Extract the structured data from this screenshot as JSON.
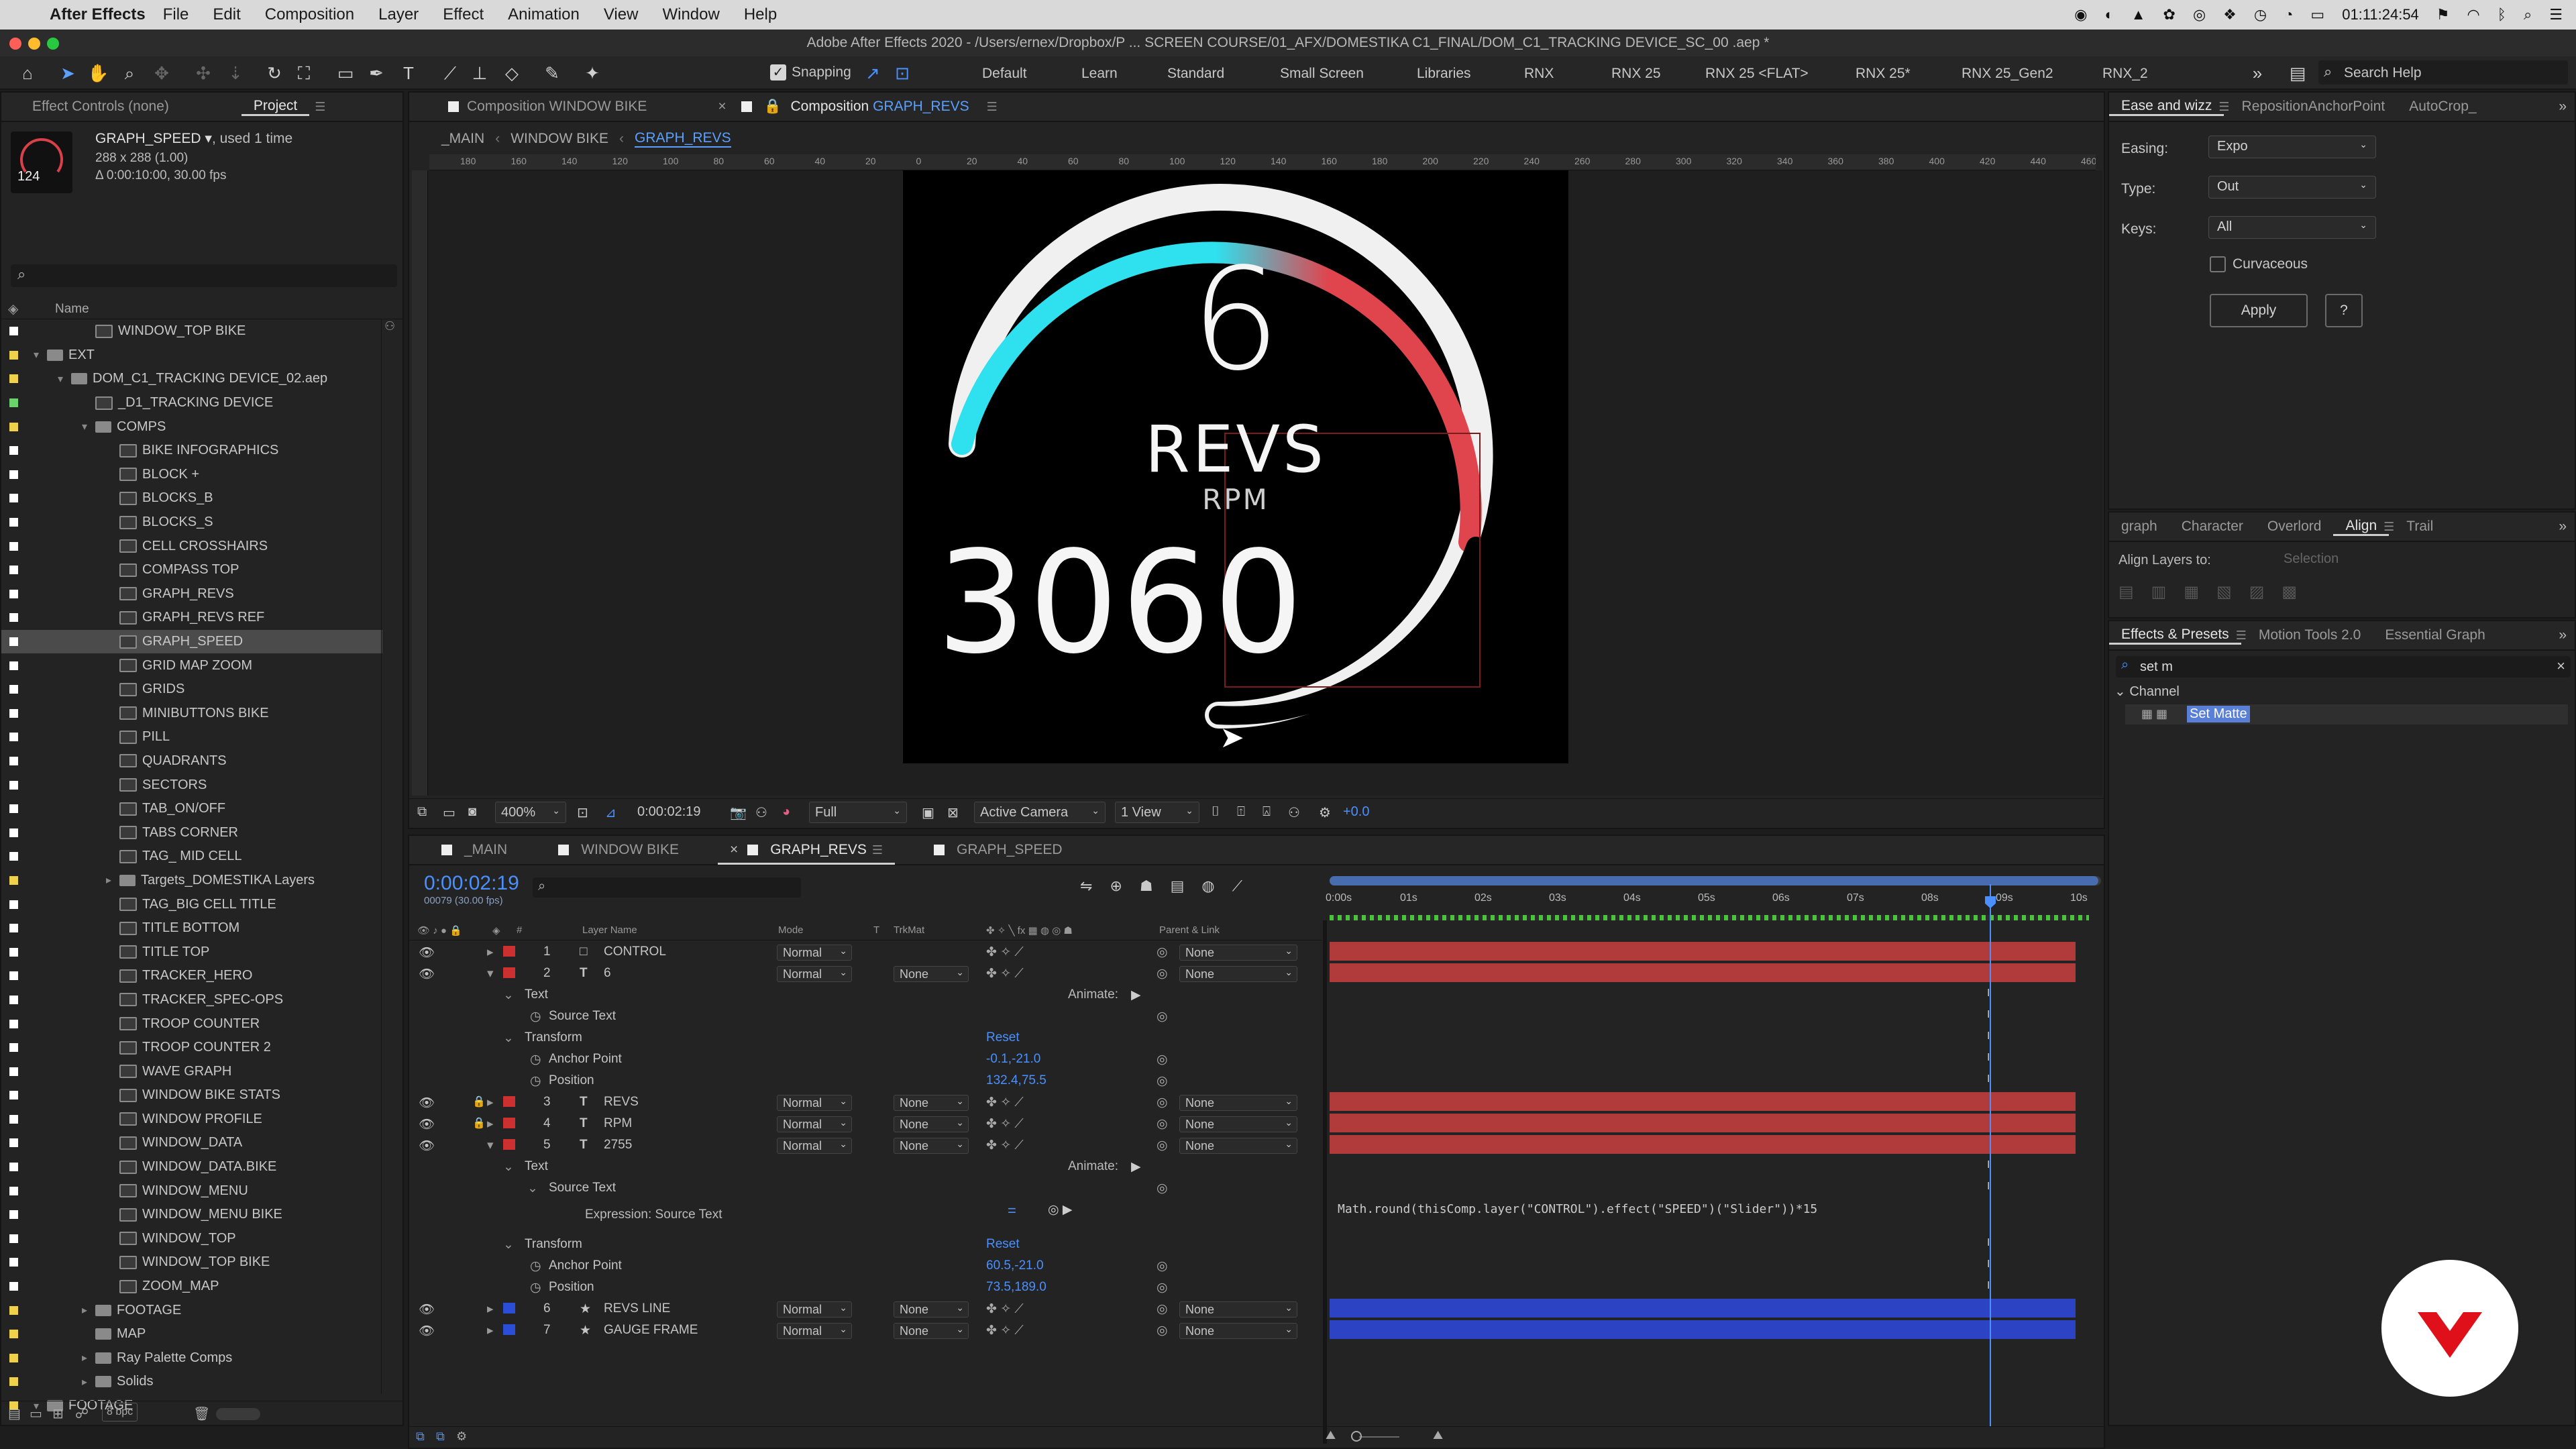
{
  "menubar": {
    "app": "After Effects",
    "items": [
      "File",
      "Edit",
      "Composition",
      "Layer",
      "Effect",
      "Animation",
      "View",
      "Window",
      "Help"
    ],
    "clock": "01:11:24:54"
  },
  "window_title": "Adobe After Effects 2020 - /Users/ernex/Dropbox/P ... SCREEN COURSE/01_AFX/DOMESTIKA C1_FINAL/DOM_C1_TRACKING DEVICE_SC_00 .aep *",
  "toolbar": {
    "snapping": "Snapping",
    "workspaces": [
      "Default",
      "Learn",
      "Standard",
      "Small Screen",
      "Libraries",
      "RNX",
      "RNX 25",
      "RNX 25 <FLAT>",
      "RNX 25*",
      "RNX 25_Gen2",
      "RNX_2"
    ],
    "search_help": "Search Help"
  },
  "left_panel": {
    "tabs": [
      "Effect Controls (none)",
      "Project"
    ],
    "selected_item": {
      "name": "GRAPH_SPEED ▾",
      "used": ", used 1 time",
      "size": "288 x 288 (1.00)",
      "duration": "Δ 0:00:10:00, 30.00 fps",
      "thumb_value": "124"
    },
    "search_placeholder": "",
    "column_name": "Name",
    "items": [
      {
        "name": "WINDOW_TOP BIKE",
        "kind": "comp",
        "indent": 2,
        "label": "#ffffff"
      },
      {
        "name": "EXT",
        "kind": "folder",
        "indent": 0,
        "twist": "▾",
        "label": "#f0d24a"
      },
      {
        "name": "DOM_C1_TRACKING DEVICE_02.aep",
        "kind": "folder",
        "indent": 1,
        "twist": "▾",
        "label": "#f0d24a"
      },
      {
        "name": "_D1_TRACKING DEVICE",
        "kind": "comp",
        "indent": 2,
        "label": "#6bd36b"
      },
      {
        "name": "COMPS",
        "kind": "folder",
        "indent": 2,
        "twist": "▾",
        "label": "#f0d24a"
      },
      {
        "name": "BIKE INFOGRAPHICS",
        "kind": "comp",
        "indent": 3,
        "label": "#ffffff"
      },
      {
        "name": "BLOCK +",
        "kind": "comp",
        "indent": 3,
        "label": "#ffffff"
      },
      {
        "name": "BLOCKS_B",
        "kind": "comp",
        "indent": 3,
        "label": "#ffffff"
      },
      {
        "name": "BLOCKS_S",
        "kind": "comp",
        "indent": 3,
        "label": "#ffffff"
      },
      {
        "name": "CELL CROSSHAIRS",
        "kind": "comp",
        "indent": 3,
        "label": "#ffffff"
      },
      {
        "name": "COMPASS TOP",
        "kind": "comp",
        "indent": 3,
        "label": "#ffffff"
      },
      {
        "name": "GRAPH_REVS",
        "kind": "comp",
        "indent": 3,
        "label": "#ffffff"
      },
      {
        "name": "GRAPH_REVS REF",
        "kind": "comp",
        "indent": 3,
        "label": "#ffffff"
      },
      {
        "name": "GRAPH_SPEED",
        "kind": "comp",
        "indent": 3,
        "label": "#ffffff",
        "selected": true
      },
      {
        "name": "GRID MAP ZOOM",
        "kind": "comp",
        "indent": 3,
        "label": "#ffffff"
      },
      {
        "name": "GRIDS",
        "kind": "comp",
        "indent": 3,
        "label": "#ffffff"
      },
      {
        "name": "MINIBUTTONS BIKE",
        "kind": "comp",
        "indent": 3,
        "label": "#ffffff"
      },
      {
        "name": "PILL",
        "kind": "comp",
        "indent": 3,
        "label": "#ffffff"
      },
      {
        "name": "QUADRANTS",
        "kind": "comp",
        "indent": 3,
        "label": "#ffffff"
      },
      {
        "name": "SECTORS",
        "kind": "comp",
        "indent": 3,
        "label": "#ffffff"
      },
      {
        "name": "TAB_ON/OFF",
        "kind": "comp",
        "indent": 3,
        "label": "#ffffff"
      },
      {
        "name": "TABS CORNER",
        "kind": "comp",
        "indent": 3,
        "label": "#ffffff"
      },
      {
        "name": "TAG_ MID CELL",
        "kind": "comp",
        "indent": 3,
        "label": "#ffffff"
      },
      {
        "name": "Targets_DOMESTIKA Layers",
        "kind": "folder",
        "indent": 3,
        "twist": "▸",
        "label": "#f0d24a"
      },
      {
        "name": "TAG_BIG CELL TITLE",
        "kind": "comp",
        "indent": 3,
        "label": "#ffffff"
      },
      {
        "name": "TITLE BOTTOM",
        "kind": "comp",
        "indent": 3,
        "label": "#ffffff"
      },
      {
        "name": "TITLE TOP",
        "kind": "comp",
        "indent": 3,
        "label": "#ffffff"
      },
      {
        "name": "TRACKER_HERO",
        "kind": "comp",
        "indent": 3,
        "label": "#ffffff"
      },
      {
        "name": "TRACKER_SPEC-OPS",
        "kind": "comp",
        "indent": 3,
        "label": "#ffffff"
      },
      {
        "name": "TROOP COUNTER",
        "kind": "comp",
        "indent": 3,
        "label": "#ffffff"
      },
      {
        "name": "TROOP COUNTER 2",
        "kind": "comp",
        "indent": 3,
        "label": "#ffffff"
      },
      {
        "name": "WAVE GRAPH",
        "kind": "comp",
        "indent": 3,
        "label": "#ffffff"
      },
      {
        "name": "WINDOW BIKE STATS",
        "kind": "comp",
        "indent": 3,
        "label": "#ffffff"
      },
      {
        "name": "WINDOW PROFILE",
        "kind": "comp",
        "indent": 3,
        "label": "#ffffff"
      },
      {
        "name": "WINDOW_DATA",
        "kind": "comp",
        "indent": 3,
        "label": "#ffffff"
      },
      {
        "name": "WINDOW_DATA.BIKE",
        "kind": "comp",
        "indent": 3,
        "label": "#ffffff"
      },
      {
        "name": "WINDOW_MENU",
        "kind": "comp",
        "indent": 3,
        "label": "#ffffff"
      },
      {
        "name": "WINDOW_MENU BIKE",
        "kind": "comp",
        "indent": 3,
        "label": "#ffffff"
      },
      {
        "name": "WINDOW_TOP",
        "kind": "comp",
        "indent": 3,
        "label": "#ffffff"
      },
      {
        "name": "WINDOW_TOP BIKE",
        "kind": "comp",
        "indent": 3,
        "label": "#ffffff"
      },
      {
        "name": "ZOOM_MAP",
        "kind": "comp",
        "indent": 3,
        "label": "#ffffff"
      },
      {
        "name": "FOOTAGE",
        "kind": "folder",
        "indent": 2,
        "twist": "▸",
        "label": "#f0d24a"
      },
      {
        "name": "MAP",
        "kind": "folder",
        "indent": 2,
        "twist": "",
        "label": "#f0d24a"
      },
      {
        "name": "Ray Palette Comps",
        "kind": "folder",
        "indent": 2,
        "twist": "▸",
        "label": "#f0d24a"
      },
      {
        "name": "Solids",
        "kind": "folder",
        "indent": 2,
        "twist": "▸",
        "label": "#f0d24a"
      },
      {
        "name": "FOOTAGE",
        "kind": "folder",
        "indent": 0,
        "twist": "▾",
        "label": "#f0d24a"
      }
    ],
    "bpc": "8 bpc"
  },
  "viewer": {
    "tab_prev": "Composition WINDOW BIKE",
    "tab_active_prefix": "Composition",
    "tab_active_name": "GRAPH_REVS",
    "breadcrumbs": [
      "_MAIN",
      "WINDOW BIKE",
      "GRAPH_REVS"
    ],
    "ruler_labels": [
      "180",
      "160",
      "140",
      "120",
      "100",
      "80",
      "60",
      "40",
      "20",
      "0",
      "20",
      "40",
      "60",
      "80",
      "100",
      "120",
      "140",
      "160",
      "180",
      "200",
      "220",
      "240",
      "260",
      "280",
      "300",
      "320",
      "340",
      "360",
      "380",
      "400",
      "420",
      "440",
      "460"
    ],
    "gauge": {
      "gear": "6",
      "label": "REVS",
      "unit": "RPM",
      "value": "3060",
      "colors": {
        "cool": "#2fe0ee",
        "hot": "#e0444d"
      }
    },
    "footer": {
      "zoom": "400%",
      "time": "0:00:02:19",
      "resolution": "Full",
      "camera": "Active Camera",
      "views": "1 View",
      "exposure": "+0.0"
    }
  },
  "timeline": {
    "tabs": [
      "_MAIN",
      "WINDOW BIKE",
      "GRAPH_REVS",
      "GRAPH_SPEED"
    ],
    "active_tab": "GRAPH_REVS",
    "timecode": "0:00:02:19",
    "frames": "00079 (30.00 fps)",
    "headers": {
      "num": "#",
      "layer": "Layer Name",
      "mode": "Mode",
      "t": "T",
      "trkmat": "TrkMat",
      "parent": "Parent & Link"
    },
    "ruler": [
      "0:00s",
      "01s",
      "02s",
      "03s",
      "04s",
      "05s",
      "06s",
      "07s",
      "08s",
      "09s",
      "10s"
    ],
    "rows": [
      {
        "type": "layer",
        "num": "1",
        "icon": "□",
        "name": "CONTROL",
        "mode": "Normal",
        "trk": "",
        "parent": "None",
        "color": "#cc3030",
        "bar": "red",
        "lock": false,
        "twist": "▸",
        "eye": true
      },
      {
        "type": "layer",
        "num": "2",
        "icon": "T",
        "name": "6",
        "mode": "Normal",
        "trk": "None",
        "parent": "None",
        "color": "#cc3030",
        "bar": "red",
        "lock": false,
        "twist": "▾",
        "eye": true
      },
      {
        "type": "group",
        "name": "Text",
        "indent": 1,
        "right": "Animate:"
      },
      {
        "type": "prop",
        "name": "Source Text",
        "indent": 2,
        "value": ""
      },
      {
        "type": "group",
        "name": "Transform",
        "indent": 1,
        "reset": "Reset"
      },
      {
        "type": "prop",
        "name": "Anchor Point",
        "indent": 2,
        "value": "-0.1,-21.0"
      },
      {
        "type": "prop",
        "name": "Position",
        "indent": 2,
        "value": "132.4,75.5"
      },
      {
        "type": "layer",
        "num": "3",
        "icon": "T",
        "name": "REVS",
        "mode": "Normal",
        "trk": "None",
        "parent": "None",
        "color": "#cc3030",
        "bar": "red",
        "lock": true,
        "twist": "▸",
        "eye": true
      },
      {
        "type": "layer",
        "num": "4",
        "icon": "T",
        "name": "RPM",
        "mode": "Normal",
        "trk": "None",
        "parent": "None",
        "color": "#cc3030",
        "bar": "red",
        "lock": true,
        "twist": "▸",
        "eye": true
      },
      {
        "type": "layer",
        "num": "5",
        "icon": "T",
        "name": "2755",
        "mode": "Normal",
        "trk": "None",
        "parent": "None",
        "color": "#cc3030",
        "bar": "red",
        "lock": false,
        "twist": "▾",
        "eye": true
      },
      {
        "type": "group",
        "name": "Text",
        "indent": 1,
        "right": "Animate:"
      },
      {
        "type": "group",
        "name": "Source Text",
        "indent": 2,
        "value": ""
      },
      {
        "type": "expr",
        "name": "Expression: Source Text",
        "code": "Math.round(thisComp.layer(\"CONTROL\").effect(\"SPEED\")(\"Slider\"))*15"
      },
      {
        "type": "group",
        "name": "Transform",
        "indent": 1,
        "reset": "Reset"
      },
      {
        "type": "prop",
        "name": "Anchor Point",
        "indent": 2,
        "value": "60.5,-21.0"
      },
      {
        "type": "prop",
        "name": "Position",
        "indent": 2,
        "value": "73.5,189.0"
      },
      {
        "type": "layer",
        "num": "6",
        "icon": "★",
        "name": "REVS LINE",
        "mode": "Normal",
        "trk": "None",
        "parent": "None",
        "color": "#2a4fd6",
        "bar": "blue",
        "lock": false,
        "twist": "▸",
        "eye": true
      },
      {
        "type": "layer",
        "num": "7",
        "icon": "★",
        "name": "GAUGE FRAME",
        "mode": "Normal",
        "trk": "None",
        "parent": "None",
        "color": "#2a4fd6",
        "bar": "blue",
        "lock": false,
        "twist": "▸",
        "eye": true
      }
    ]
  },
  "right_panel": {
    "ease_tabs": [
      "Ease and wizz",
      "RepositionAnchorPoint",
      "AutoCrop_"
    ],
    "easing_label": "Easing:",
    "easing": "Expo",
    "type_label": "Type:",
    "type": "Out",
    "keys_label": "Keys:",
    "keys": "All",
    "curvaceous": "Curvaceous",
    "apply": "Apply",
    "help": "?",
    "mid_tabs": [
      "graph",
      "Character",
      "Overlord",
      "Align",
      "Trail"
    ],
    "align_to_label": "Align Layers to:",
    "align_to": "Selection",
    "fx_tabs": [
      "Effects & Presets",
      "Motion Tools 2.0",
      "Essential Graph"
    ],
    "fx_search": "set m",
    "fx_folder": "Channel",
    "fx_item": "Set Matte"
  }
}
